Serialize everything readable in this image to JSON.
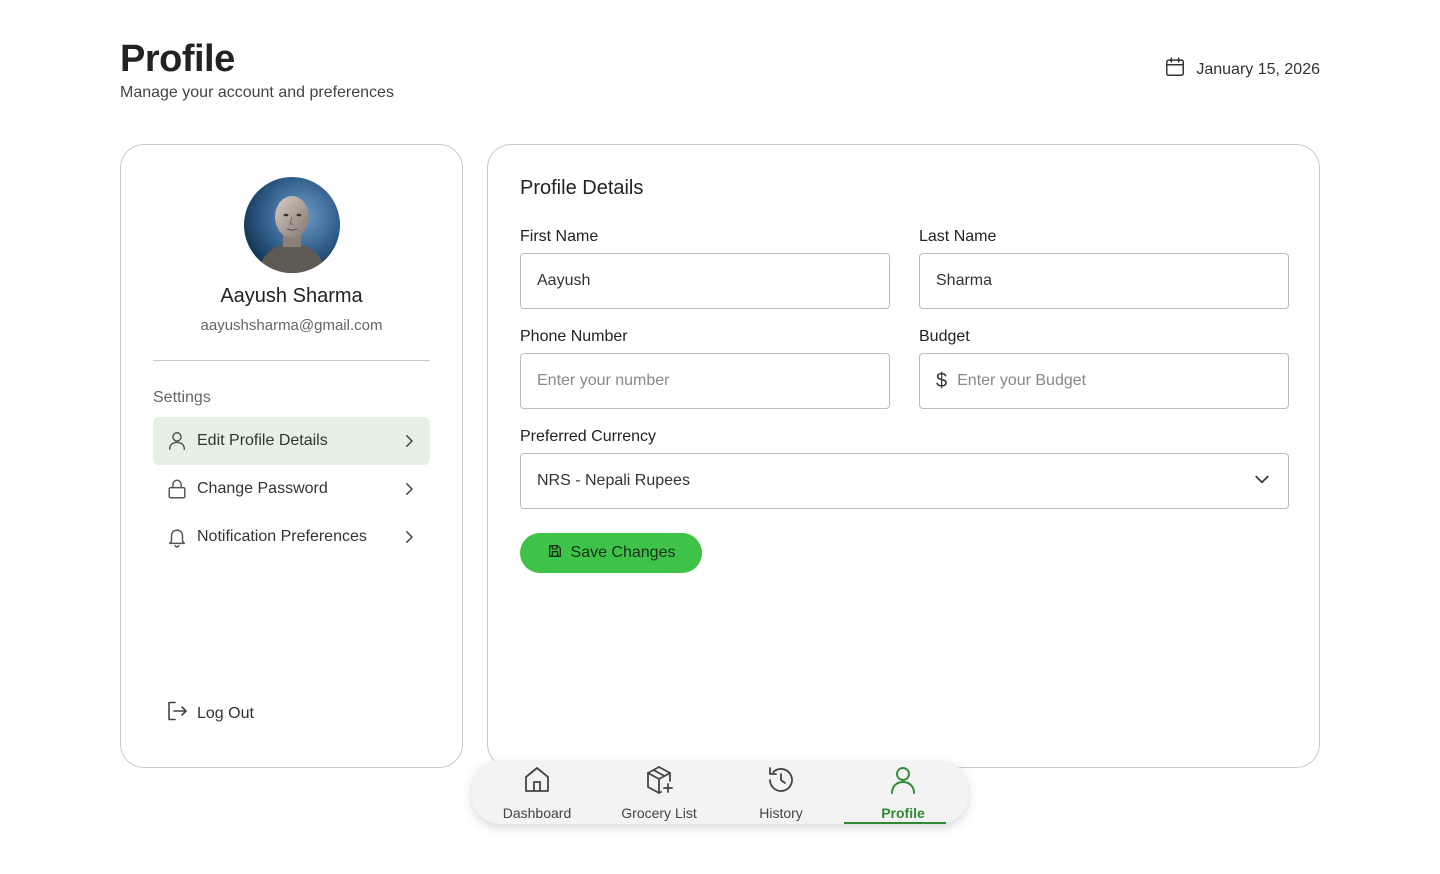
{
  "header": {
    "title": "Profile",
    "subtitle": "Manage your account and preferences",
    "date": "January 15, 2026"
  },
  "profile": {
    "name": "Aayush Sharma",
    "email": "aayushsharma@gmail.com"
  },
  "sidebar": {
    "settings_heading": "Settings",
    "items": [
      {
        "label": "Edit Profile Details",
        "icon": "user-icon",
        "active": true
      },
      {
        "label": "Change Password",
        "icon": "lock-icon",
        "active": false
      },
      {
        "label": "Notification Preferences",
        "icon": "bell-icon",
        "active": false
      }
    ],
    "logout_label": "Log Out"
  },
  "form": {
    "title": "Profile Details",
    "first_name": {
      "label": "First Name",
      "value": "Aayush"
    },
    "last_name": {
      "label": "Last Name",
      "value": "Sharma"
    },
    "phone": {
      "label": "Phone Number",
      "value": "",
      "placeholder": "Enter your number"
    },
    "budget": {
      "label": "Budget",
      "value": "",
      "placeholder": "Enter your Budget",
      "prefix": "$"
    },
    "currency": {
      "label": "Preferred Currency",
      "selected": "NRS - Nepali Rupees"
    },
    "save_label": "Save Changes"
  },
  "bottom_nav": {
    "items": [
      {
        "label": "Dashboard",
        "icon": "home-icon"
      },
      {
        "label": "Grocery List",
        "icon": "package-plus-icon"
      },
      {
        "label": "History",
        "icon": "history-icon"
      },
      {
        "label": "Profile",
        "icon": "user-icon",
        "active": true
      }
    ]
  },
  "colors": {
    "accent": "#3fc248",
    "active_nav": "#2e8b34",
    "active_menu_bg": "#e4f1e3",
    "border": "#c9c9c9"
  }
}
